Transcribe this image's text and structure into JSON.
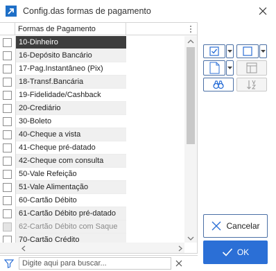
{
  "window": {
    "title": "Config.das formas de pagamento",
    "icons": {
      "app": "app-arrow-icon",
      "close": "close-icon"
    }
  },
  "grid": {
    "column_header": "Formas de Pagamento",
    "rows": [
      {
        "label": "10-Dinheiro",
        "state": "selected"
      },
      {
        "label": "16-Depósito Bancário",
        "state": "normal"
      },
      {
        "label": "17-Pag.Instantâneo (Pix)",
        "state": "normal"
      },
      {
        "label": "18-Transf.Bancária",
        "state": "normal"
      },
      {
        "label": "19-Fidelidade/Cashback",
        "state": "normal"
      },
      {
        "label": "20-Crediário",
        "state": "normal"
      },
      {
        "label": "30-Boleto",
        "state": "normal"
      },
      {
        "label": "40-Cheque a vista",
        "state": "normal"
      },
      {
        "label": "41-Cheque pré-datado",
        "state": "normal"
      },
      {
        "label": "42-Cheque com consulta",
        "state": "normal"
      },
      {
        "label": "50-Vale Refeição",
        "state": "normal"
      },
      {
        "label": "51-Vale Alimentação",
        "state": "normal"
      },
      {
        "label": "60-Cartão Débito",
        "state": "normal"
      },
      {
        "label": "61-Cartão Débito pré-datado",
        "state": "normal"
      },
      {
        "label": "62-Cartão Débito com Saque",
        "state": "disabled"
      },
      {
        "label": "70-Cartão Crédito",
        "state": "normal"
      }
    ]
  },
  "search": {
    "placeholder": "Digite aqui para buscar...",
    "value": ""
  },
  "toolbar": {
    "icons": [
      "check-all-icon",
      "uncheck-all-icon",
      "export-xls-icon",
      "columns-icon",
      "find-binoculars-icon",
      "sort-az-icon"
    ]
  },
  "buttons": {
    "cancel_label": "Cancelar",
    "ok_label": "OK"
  },
  "colors": {
    "accent": "#2b6fd6",
    "selected_row": "#3d3d3d",
    "alt_row": "#f0f0f0",
    "border_accent": "#4a6fa5",
    "app_icon": "#1e6fc7"
  }
}
